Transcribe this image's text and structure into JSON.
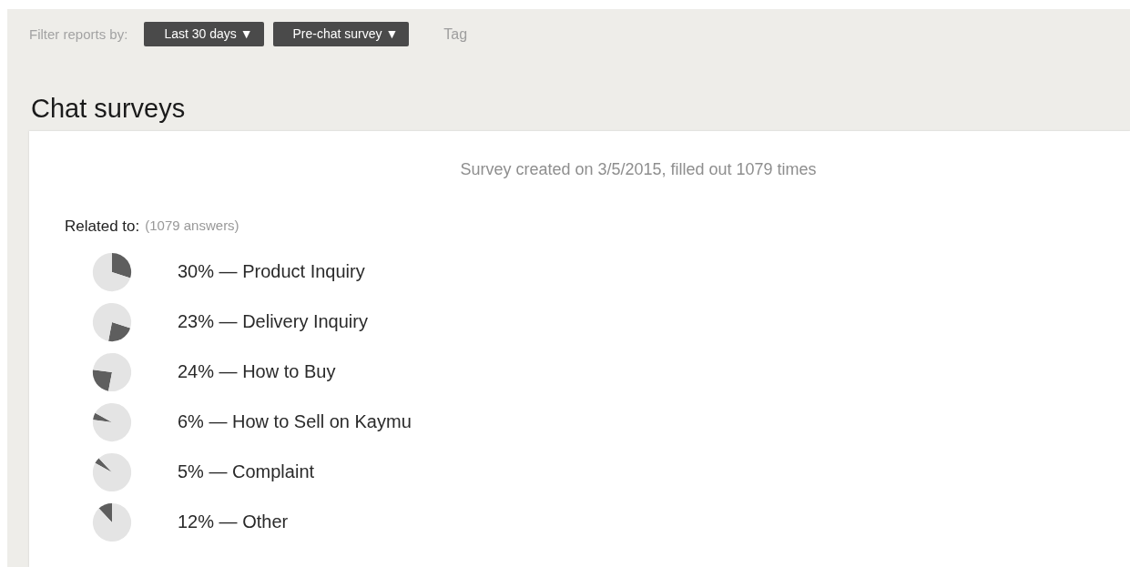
{
  "filter_bar": {
    "label": "Filter reports by:",
    "dropdowns": [
      "Last 30 days ▼",
      "Pre-chat survey ▼"
    ],
    "tag": "Tag"
  },
  "heading": "Chat surveys",
  "survey": {
    "summary": "Survey created on 3/5/2015, filled out 1079 times",
    "question": "Related to:",
    "answers_count": "(1079 answers)",
    "answers": [
      {
        "label": "30% — Product Inquiry",
        "chart_data": {
          "type": "pie",
          "values": [
            30,
            70
          ]
        }
      },
      {
        "label": "23% — Delivery Inquiry",
        "chart_data": {
          "type": "pie",
          "values": [
            23,
            77
          ]
        }
      },
      {
        "label": "24% — How to Buy",
        "chart_data": {
          "type": "pie",
          "values": [
            24,
            76
          ]
        }
      },
      {
        "label": "6% — How to Sell on Kaymu",
        "chart_data": {
          "type": "pie",
          "values": [
            6,
            94
          ]
        }
      },
      {
        "label": "5% — Complaint",
        "chart_data": {
          "type": "pie",
          "values": [
            5,
            95
          ]
        }
      },
      {
        "label": "12% — Other",
        "chart_data": {
          "type": "pie",
          "values": [
            12,
            88
          ]
        }
      }
    ]
  }
}
